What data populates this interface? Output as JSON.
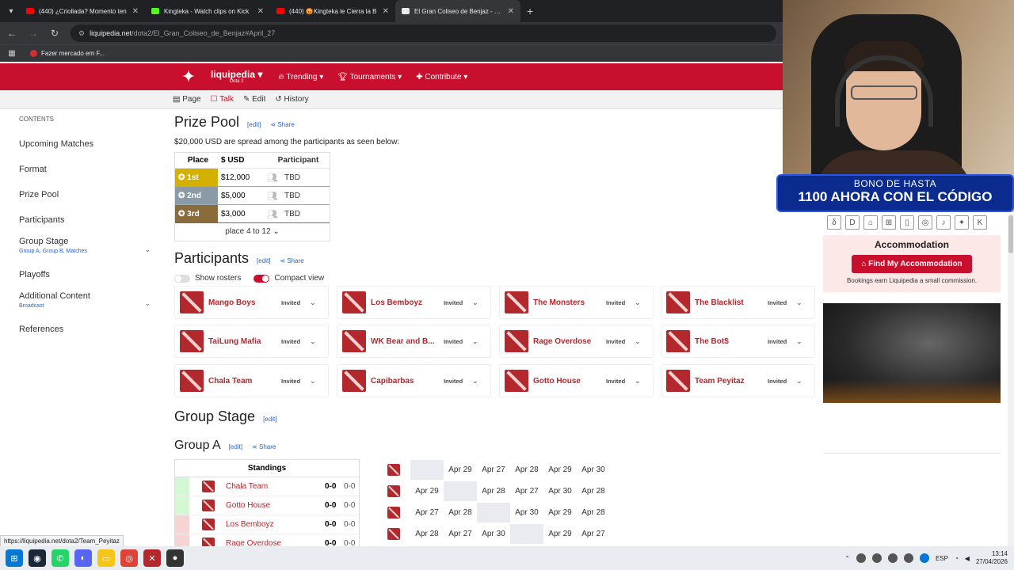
{
  "browser": {
    "tabs": [
      {
        "title": "(440) ¿Criollada? Momento ten",
        "color": "#ff0000",
        "active": false
      },
      {
        "title": "Kingteka - Watch clips on Kick",
        "color": "#53fc18",
        "active": false
      },
      {
        "title": "(440) 😡Kingteka le Cierra la B",
        "color": "#ff0000",
        "active": false
      },
      {
        "title": "El Gran Coliseo de Benjaz - Liqu",
        "color": "#e8eaed",
        "active": true
      }
    ],
    "url_host": "liquipedia.net",
    "url_path": "/dota2/El_Gran_Coliseo_de_Benjaz#April_27",
    "bookmark": "Fazer mercado em F..."
  },
  "site": {
    "brand": "liquipedia",
    "brand_sub": "Dota 2",
    "nav": [
      "Trending",
      "Tournaments",
      "Contribute"
    ],
    "page_actions": [
      "Page",
      "Talk",
      "Edit",
      "History"
    ]
  },
  "toc": {
    "header": "CONTENTS",
    "items": [
      {
        "label": "Upcoming Matches",
        "sub": ""
      },
      {
        "label": "Format",
        "sub": ""
      },
      {
        "label": "Prize Pool",
        "sub": ""
      },
      {
        "label": "Participants",
        "sub": ""
      },
      {
        "label": "Group Stage",
        "sub": "Group A, Group B, Matches"
      },
      {
        "label": "Playoffs",
        "sub": ""
      },
      {
        "label": "Additional Content",
        "sub": "Broadcast"
      },
      {
        "label": "References",
        "sub": ""
      }
    ]
  },
  "prize": {
    "title": "Prize Pool",
    "edit": "[edit]",
    "share": "Share",
    "desc": "$20,000 USD are spread among the participants as seen below:",
    "headers": [
      "Place",
      "$ USD",
      "Participant"
    ],
    "rows": [
      {
        "place": "1st",
        "amount": "$12,000",
        "participant": "TBD"
      },
      {
        "place": "2nd",
        "amount": "$5,000",
        "participant": "TBD"
      },
      {
        "place": "3rd",
        "amount": "$3,000",
        "participant": "TBD"
      }
    ],
    "more": "place 4 to 12"
  },
  "participants": {
    "title": "Participants",
    "edit": "[edit]",
    "share": "Share",
    "show_rosters": "Show rosters",
    "compact_view": "Compact view",
    "status": "Invited",
    "teams": [
      "Mango Boys",
      "Los Bemboyz",
      "The Monsters",
      "The Blacklist",
      "TaiLung Mafia",
      "WK Bear and B...",
      "Rage Overdose",
      "The Bot$",
      "Chala Team",
      "Capibarbas",
      "Gotto House",
      "Team Peyitaz"
    ]
  },
  "group_stage": {
    "title": "Group Stage",
    "edit": "[edit]",
    "group_a": "Group A",
    "standings_header": "Standings",
    "standings": [
      {
        "name": "Chala Team",
        "score": "0-0",
        "score2": "0-0",
        "color": "#d4f7d4"
      },
      {
        "name": "Gotto House",
        "score": "0-0",
        "score2": "0-0",
        "color": "#d4f7d4"
      },
      {
        "name": "Los Bemboyz",
        "score": "0-0",
        "score2": "0-0",
        "color": "#f7d4d4"
      },
      {
        "name": "Rage Overdose",
        "score": "0-0",
        "score2": "0-0",
        "color": "#f7d4d4"
      }
    ],
    "matrix": [
      [
        "",
        "Apr 29",
        "Apr 27",
        "Apr 28",
        "Apr 29",
        "Apr 30"
      ],
      [
        "Apr 29",
        "",
        "Apr 28",
        "Apr 27",
        "Apr 30",
        "Apr 28"
      ],
      [
        "Apr 27",
        "Apr 28",
        "",
        "Apr 30",
        "Apr 29",
        "Apr 28"
      ],
      [
        "Apr 28",
        "Apr 27",
        "Apr 30",
        "",
        "Apr 29",
        "Apr 27"
      ]
    ]
  },
  "sidebar_right": {
    "promo_line1": "BONO DE HASTA",
    "promo_line2": "1100 AHORA CON EL CÓDIGO",
    "accom_title": "Accommodation",
    "accom_button": "Find My Accommodation",
    "accom_note": "Bookings earn Liquipedia a small commission."
  },
  "statusbar_url": "https://liquipedia.net/dota2/Team_Peyitaz",
  "taskbar": {
    "lang": "ESP",
    "time": "13:14",
    "date": "27/04/2026"
  }
}
